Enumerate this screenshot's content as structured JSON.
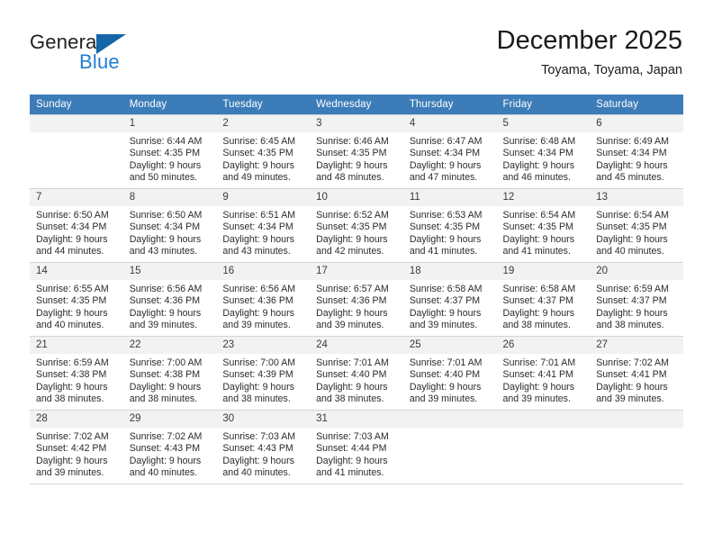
{
  "brand": {
    "word1": "General",
    "word2": "Blue",
    "triangle_color": "#1565a8",
    "blue_color": "#1f7fd0"
  },
  "header": {
    "title": "December 2025",
    "subtitle": "Toyama, Toyama, Japan"
  },
  "theme": {
    "header_row_bg": "#3c7cb8",
    "daynum_bg": "#f2f2f2",
    "grid_line": "#cfd6dd"
  },
  "calendar": {
    "weekdays": [
      "Sunday",
      "Monday",
      "Tuesday",
      "Wednesday",
      "Thursday",
      "Friday",
      "Saturday"
    ],
    "weeks": [
      [
        {
          "day": "",
          "sunrise": "",
          "sunset": "",
          "daylight1": "",
          "daylight2": ""
        },
        {
          "day": "1",
          "sunrise": "Sunrise: 6:44 AM",
          "sunset": "Sunset: 4:35 PM",
          "daylight1": "Daylight: 9 hours",
          "daylight2": "and 50 minutes."
        },
        {
          "day": "2",
          "sunrise": "Sunrise: 6:45 AM",
          "sunset": "Sunset: 4:35 PM",
          "daylight1": "Daylight: 9 hours",
          "daylight2": "and 49 minutes."
        },
        {
          "day": "3",
          "sunrise": "Sunrise: 6:46 AM",
          "sunset": "Sunset: 4:35 PM",
          "daylight1": "Daylight: 9 hours",
          "daylight2": "and 48 minutes."
        },
        {
          "day": "4",
          "sunrise": "Sunrise: 6:47 AM",
          "sunset": "Sunset: 4:34 PM",
          "daylight1": "Daylight: 9 hours",
          "daylight2": "and 47 minutes."
        },
        {
          "day": "5",
          "sunrise": "Sunrise: 6:48 AM",
          "sunset": "Sunset: 4:34 PM",
          "daylight1": "Daylight: 9 hours",
          "daylight2": "and 46 minutes."
        },
        {
          "day": "6",
          "sunrise": "Sunrise: 6:49 AM",
          "sunset": "Sunset: 4:34 PM",
          "daylight1": "Daylight: 9 hours",
          "daylight2": "and 45 minutes."
        }
      ],
      [
        {
          "day": "7",
          "sunrise": "Sunrise: 6:50 AM",
          "sunset": "Sunset: 4:34 PM",
          "daylight1": "Daylight: 9 hours",
          "daylight2": "and 44 minutes."
        },
        {
          "day": "8",
          "sunrise": "Sunrise: 6:50 AM",
          "sunset": "Sunset: 4:34 PM",
          "daylight1": "Daylight: 9 hours",
          "daylight2": "and 43 minutes."
        },
        {
          "day": "9",
          "sunrise": "Sunrise: 6:51 AM",
          "sunset": "Sunset: 4:34 PM",
          "daylight1": "Daylight: 9 hours",
          "daylight2": "and 43 minutes."
        },
        {
          "day": "10",
          "sunrise": "Sunrise: 6:52 AM",
          "sunset": "Sunset: 4:35 PM",
          "daylight1": "Daylight: 9 hours",
          "daylight2": "and 42 minutes."
        },
        {
          "day": "11",
          "sunrise": "Sunrise: 6:53 AM",
          "sunset": "Sunset: 4:35 PM",
          "daylight1": "Daylight: 9 hours",
          "daylight2": "and 41 minutes."
        },
        {
          "day": "12",
          "sunrise": "Sunrise: 6:54 AM",
          "sunset": "Sunset: 4:35 PM",
          "daylight1": "Daylight: 9 hours",
          "daylight2": "and 41 minutes."
        },
        {
          "day": "13",
          "sunrise": "Sunrise: 6:54 AM",
          "sunset": "Sunset: 4:35 PM",
          "daylight1": "Daylight: 9 hours",
          "daylight2": "and 40 minutes."
        }
      ],
      [
        {
          "day": "14",
          "sunrise": "Sunrise: 6:55 AM",
          "sunset": "Sunset: 4:35 PM",
          "daylight1": "Daylight: 9 hours",
          "daylight2": "and 40 minutes."
        },
        {
          "day": "15",
          "sunrise": "Sunrise: 6:56 AM",
          "sunset": "Sunset: 4:36 PM",
          "daylight1": "Daylight: 9 hours",
          "daylight2": "and 39 minutes."
        },
        {
          "day": "16",
          "sunrise": "Sunrise: 6:56 AM",
          "sunset": "Sunset: 4:36 PM",
          "daylight1": "Daylight: 9 hours",
          "daylight2": "and 39 minutes."
        },
        {
          "day": "17",
          "sunrise": "Sunrise: 6:57 AM",
          "sunset": "Sunset: 4:36 PM",
          "daylight1": "Daylight: 9 hours",
          "daylight2": "and 39 minutes."
        },
        {
          "day": "18",
          "sunrise": "Sunrise: 6:58 AM",
          "sunset": "Sunset: 4:37 PM",
          "daylight1": "Daylight: 9 hours",
          "daylight2": "and 39 minutes."
        },
        {
          "day": "19",
          "sunrise": "Sunrise: 6:58 AM",
          "sunset": "Sunset: 4:37 PM",
          "daylight1": "Daylight: 9 hours",
          "daylight2": "and 38 minutes."
        },
        {
          "day": "20",
          "sunrise": "Sunrise: 6:59 AM",
          "sunset": "Sunset: 4:37 PM",
          "daylight1": "Daylight: 9 hours",
          "daylight2": "and 38 minutes."
        }
      ],
      [
        {
          "day": "21",
          "sunrise": "Sunrise: 6:59 AM",
          "sunset": "Sunset: 4:38 PM",
          "daylight1": "Daylight: 9 hours",
          "daylight2": "and 38 minutes."
        },
        {
          "day": "22",
          "sunrise": "Sunrise: 7:00 AM",
          "sunset": "Sunset: 4:38 PM",
          "daylight1": "Daylight: 9 hours",
          "daylight2": "and 38 minutes."
        },
        {
          "day": "23",
          "sunrise": "Sunrise: 7:00 AM",
          "sunset": "Sunset: 4:39 PM",
          "daylight1": "Daylight: 9 hours",
          "daylight2": "and 38 minutes."
        },
        {
          "day": "24",
          "sunrise": "Sunrise: 7:01 AM",
          "sunset": "Sunset: 4:40 PM",
          "daylight1": "Daylight: 9 hours",
          "daylight2": "and 38 minutes."
        },
        {
          "day": "25",
          "sunrise": "Sunrise: 7:01 AM",
          "sunset": "Sunset: 4:40 PM",
          "daylight1": "Daylight: 9 hours",
          "daylight2": "and 39 minutes."
        },
        {
          "day": "26",
          "sunrise": "Sunrise: 7:01 AM",
          "sunset": "Sunset: 4:41 PM",
          "daylight1": "Daylight: 9 hours",
          "daylight2": "and 39 minutes."
        },
        {
          "day": "27",
          "sunrise": "Sunrise: 7:02 AM",
          "sunset": "Sunset: 4:41 PM",
          "daylight1": "Daylight: 9 hours",
          "daylight2": "and 39 minutes."
        }
      ],
      [
        {
          "day": "28",
          "sunrise": "Sunrise: 7:02 AM",
          "sunset": "Sunset: 4:42 PM",
          "daylight1": "Daylight: 9 hours",
          "daylight2": "and 39 minutes."
        },
        {
          "day": "29",
          "sunrise": "Sunrise: 7:02 AM",
          "sunset": "Sunset: 4:43 PM",
          "daylight1": "Daylight: 9 hours",
          "daylight2": "and 40 minutes."
        },
        {
          "day": "30",
          "sunrise": "Sunrise: 7:03 AM",
          "sunset": "Sunset: 4:43 PM",
          "daylight1": "Daylight: 9 hours",
          "daylight2": "and 40 minutes."
        },
        {
          "day": "31",
          "sunrise": "Sunrise: 7:03 AM",
          "sunset": "Sunset: 4:44 PM",
          "daylight1": "Daylight: 9 hours",
          "daylight2": "and 41 minutes."
        },
        {
          "day": "",
          "sunrise": "",
          "sunset": "",
          "daylight1": "",
          "daylight2": ""
        },
        {
          "day": "",
          "sunrise": "",
          "sunset": "",
          "daylight1": "",
          "daylight2": ""
        },
        {
          "day": "",
          "sunrise": "",
          "sunset": "",
          "daylight1": "",
          "daylight2": ""
        }
      ]
    ]
  }
}
